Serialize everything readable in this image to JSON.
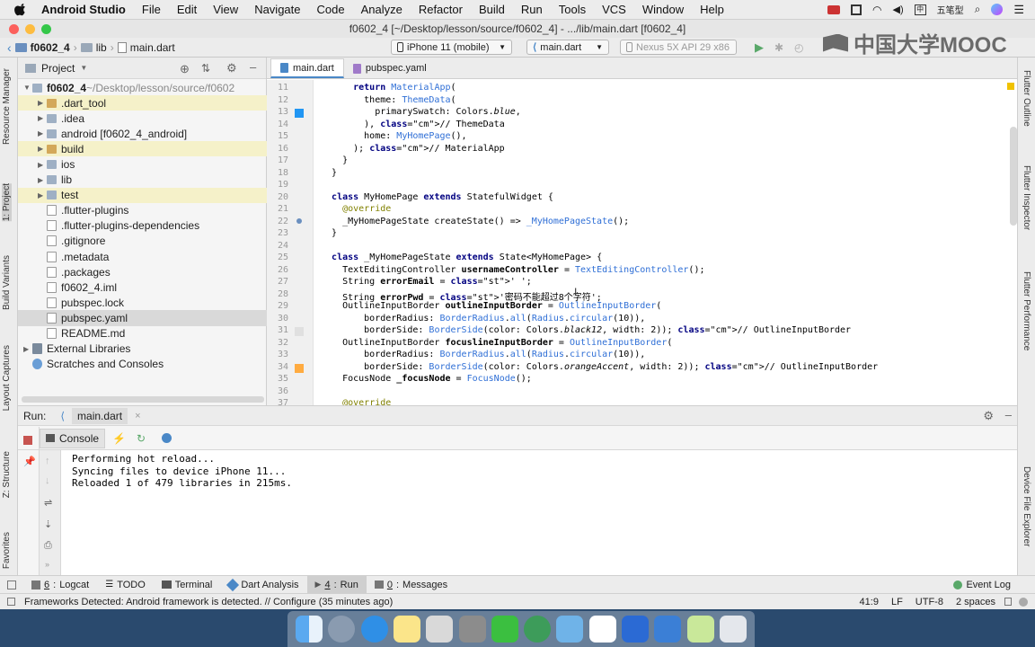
{
  "menubar": {
    "app": "Android Studio",
    "items": [
      "File",
      "Edit",
      "View",
      "Navigate",
      "Code",
      "Analyze",
      "Refactor",
      "Build",
      "Run",
      "Tools",
      "VCS",
      "Window",
      "Help"
    ],
    "input_method": "五笔型"
  },
  "window": {
    "title": "f0602_4 [~/Desktop/lesson/source/f0602_4] - .../lib/main.dart [f0602_4]"
  },
  "toolbar": {
    "breadcrumb": [
      "f0602_4",
      "lib",
      "main.dart"
    ],
    "device": "iPhone 11 (mobile)",
    "config": "main.dart",
    "avd": "Nexus 5X API 29 x86"
  },
  "watermark": "中国大学MOOC",
  "left_tools": [
    "Resource Manager",
    "1: Project",
    "Build Variants",
    "Layout Captures",
    "Z: Structure",
    "Favorites"
  ],
  "right_tools": [
    "Flutter Outline",
    "Flutter Inspector",
    "Flutter Performance",
    "Device File Explorer"
  ],
  "project": {
    "header": "Project",
    "tree": [
      {
        "name": "f0602_4",
        "extra": " ~/Desktop/lesson/source/f0602",
        "indent": 0,
        "arrow": "▼",
        "icon": "folder-icon",
        "bold": true
      },
      {
        "name": ".dart_tool",
        "indent": 1,
        "arrow": "▶",
        "icon": "folder-icon",
        "hl": true
      },
      {
        "name": ".idea",
        "indent": 1,
        "arrow": "▶",
        "icon": "folder-icon"
      },
      {
        "name": "android [f0602_4_android]",
        "indent": 1,
        "arrow": "▶",
        "icon": "folder-icon",
        "bold_part": "[f0602_4_android]"
      },
      {
        "name": "build",
        "indent": 1,
        "arrow": "▶",
        "icon": "folder-icon",
        "hl": true
      },
      {
        "name": "ios",
        "indent": 1,
        "arrow": "▶",
        "icon": "folder-icon"
      },
      {
        "name": "lib",
        "indent": 1,
        "arrow": "▶",
        "icon": "folder-icon"
      },
      {
        "name": "test",
        "indent": 1,
        "arrow": "▶",
        "icon": "folder-icon",
        "hl": true
      },
      {
        "name": ".flutter-plugins",
        "indent": 1,
        "arrow": "",
        "icon": "file-icon"
      },
      {
        "name": ".flutter-plugins-dependencies",
        "indent": 1,
        "arrow": "",
        "icon": "file-icon"
      },
      {
        "name": ".gitignore",
        "indent": 1,
        "arrow": "",
        "icon": "file-icon"
      },
      {
        "name": ".metadata",
        "indent": 1,
        "arrow": "",
        "icon": "file-icon"
      },
      {
        "name": ".packages",
        "indent": 1,
        "arrow": "",
        "icon": "file-icon"
      },
      {
        "name": "f0602_4.iml",
        "indent": 1,
        "arrow": "",
        "icon": "file-icon"
      },
      {
        "name": "pubspec.lock",
        "indent": 1,
        "arrow": "",
        "icon": "file-icon"
      },
      {
        "name": "pubspec.yaml",
        "indent": 1,
        "arrow": "",
        "icon": "file-icon",
        "sel": true
      },
      {
        "name": "README.md",
        "indent": 1,
        "arrow": "",
        "icon": "file-icon"
      },
      {
        "name": "External Libraries",
        "indent": 0,
        "arrow": "▶",
        "icon": "library-icon"
      },
      {
        "name": "Scratches and Consoles",
        "indent": 0,
        "arrow": "",
        "icon": "scratch-icon"
      }
    ]
  },
  "editor": {
    "tabs": [
      "main.dart",
      "pubspec.yaml"
    ],
    "line_numbers": [
      "11",
      "12",
      "13",
      "14",
      "15",
      "16",
      "17",
      "18",
      "19",
      "20",
      "21",
      "22",
      "23",
      "24",
      "25",
      "26",
      "27",
      "28",
      "29",
      "30",
      "31",
      "32",
      "33",
      "34",
      "35",
      "36",
      "37"
    ],
    "code_lines": [
      "      return MaterialApp(",
      "        theme: ThemeData(",
      "          primarySwatch: Colors.blue,",
      "        ), // ThemeData",
      "        home: MyHomePage(),",
      "      ); // MaterialApp",
      "    }",
      "  }",
      "",
      "  class MyHomePage extends StatefulWidget {",
      "    @override",
      "    _MyHomePageState createState() => _MyHomePageState();",
      "  }",
      "",
      "  class _MyHomePageState extends State<MyHomePage> {",
      "    TextEditingController usernameController = TextEditingController();",
      "    String errorEmail = ' ';",
      "    String errorPwd = '密码不能超过8个字符';",
      "    OutlineInputBorder outlineInputBorder = OutlineInputBorder(",
      "        borderRadius: BorderRadius.all(Radius.circular(10)),",
      "        borderSide: BorderSide(color: Colors.black12, width: 2)); // OutlineInputBorder",
      "    OutlineInputBorder focuslineInputBorder = OutlineInputBorder(",
      "        borderRadius: BorderRadius.all(Radius.circular(10)),",
      "        borderSide: BorderSide(color: Colors.orangeAccent, width: 2)); // OutlineInputBorder",
      "    FocusNode _focusNode = FocusNode();",
      "",
      "    @override"
    ]
  },
  "run": {
    "label": "Run:",
    "config": "main.dart",
    "console_tab": "Console",
    "output": [
      "Performing hot reload...",
      "Syncing files to device iPhone 11...",
      "Reloaded 1 of 479 libraries in 215ms."
    ]
  },
  "bottom_tabs": [
    {
      "key": "6",
      "label": "Logcat",
      "icon": "logcat-icon"
    },
    {
      "key": "",
      "label": "TODO",
      "icon": "todo-icon"
    },
    {
      "key": "",
      "label": "Terminal",
      "icon": "terminal-icon"
    },
    {
      "key": "",
      "label": "Dart Analysis",
      "icon": "dart-analysis-icon"
    },
    {
      "key": "4",
      "label": "Run",
      "icon": "run-icon",
      "active": true
    },
    {
      "key": "0",
      "label": "Messages",
      "icon": "messages-icon"
    }
  ],
  "event_log": "Event Log",
  "status": {
    "message": "Frameworks Detected: Android framework is detected. // Configure (35 minutes ago)",
    "position": "41:9",
    "line_sep": "LF",
    "encoding": "UTF-8",
    "indent": "2 spaces"
  },
  "colors": {
    "accent": "#4a88c7",
    "run_green": "#59a869",
    "stop_red": "#c75450"
  }
}
